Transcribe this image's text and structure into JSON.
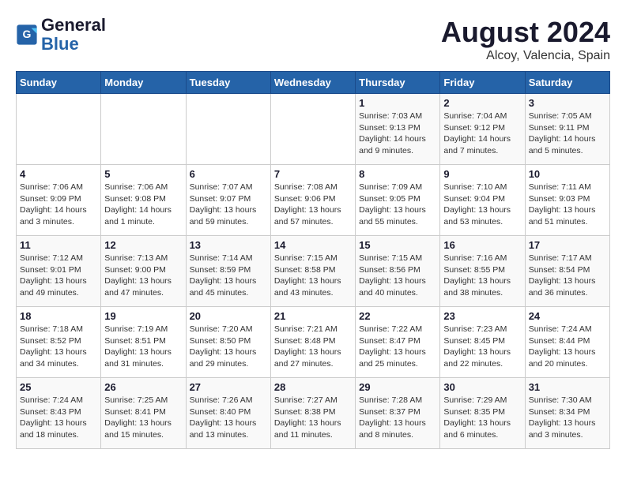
{
  "logo": {
    "text_general": "General",
    "text_blue": "Blue"
  },
  "title": "August 2024",
  "subtitle": "Alcoy, Valencia, Spain",
  "days_of_week": [
    "Sunday",
    "Monday",
    "Tuesday",
    "Wednesday",
    "Thursday",
    "Friday",
    "Saturday"
  ],
  "weeks": [
    [
      {
        "day": "",
        "info": ""
      },
      {
        "day": "",
        "info": ""
      },
      {
        "day": "",
        "info": ""
      },
      {
        "day": "",
        "info": ""
      },
      {
        "day": "1",
        "info": "Sunrise: 7:03 AM\nSunset: 9:13 PM\nDaylight: 14 hours and 9 minutes."
      },
      {
        "day": "2",
        "info": "Sunrise: 7:04 AM\nSunset: 9:12 PM\nDaylight: 14 hours and 7 minutes."
      },
      {
        "day": "3",
        "info": "Sunrise: 7:05 AM\nSunset: 9:11 PM\nDaylight: 14 hours and 5 minutes."
      }
    ],
    [
      {
        "day": "4",
        "info": "Sunrise: 7:06 AM\nSunset: 9:09 PM\nDaylight: 14 hours and 3 minutes."
      },
      {
        "day": "5",
        "info": "Sunrise: 7:06 AM\nSunset: 9:08 PM\nDaylight: 14 hours and 1 minute."
      },
      {
        "day": "6",
        "info": "Sunrise: 7:07 AM\nSunset: 9:07 PM\nDaylight: 13 hours and 59 minutes."
      },
      {
        "day": "7",
        "info": "Sunrise: 7:08 AM\nSunset: 9:06 PM\nDaylight: 13 hours and 57 minutes."
      },
      {
        "day": "8",
        "info": "Sunrise: 7:09 AM\nSunset: 9:05 PM\nDaylight: 13 hours and 55 minutes."
      },
      {
        "day": "9",
        "info": "Sunrise: 7:10 AM\nSunset: 9:04 PM\nDaylight: 13 hours and 53 minutes."
      },
      {
        "day": "10",
        "info": "Sunrise: 7:11 AM\nSunset: 9:03 PM\nDaylight: 13 hours and 51 minutes."
      }
    ],
    [
      {
        "day": "11",
        "info": "Sunrise: 7:12 AM\nSunset: 9:01 PM\nDaylight: 13 hours and 49 minutes."
      },
      {
        "day": "12",
        "info": "Sunrise: 7:13 AM\nSunset: 9:00 PM\nDaylight: 13 hours and 47 minutes."
      },
      {
        "day": "13",
        "info": "Sunrise: 7:14 AM\nSunset: 8:59 PM\nDaylight: 13 hours and 45 minutes."
      },
      {
        "day": "14",
        "info": "Sunrise: 7:15 AM\nSunset: 8:58 PM\nDaylight: 13 hours and 43 minutes."
      },
      {
        "day": "15",
        "info": "Sunrise: 7:15 AM\nSunset: 8:56 PM\nDaylight: 13 hours and 40 minutes."
      },
      {
        "day": "16",
        "info": "Sunrise: 7:16 AM\nSunset: 8:55 PM\nDaylight: 13 hours and 38 minutes."
      },
      {
        "day": "17",
        "info": "Sunrise: 7:17 AM\nSunset: 8:54 PM\nDaylight: 13 hours and 36 minutes."
      }
    ],
    [
      {
        "day": "18",
        "info": "Sunrise: 7:18 AM\nSunset: 8:52 PM\nDaylight: 13 hours and 34 minutes."
      },
      {
        "day": "19",
        "info": "Sunrise: 7:19 AM\nSunset: 8:51 PM\nDaylight: 13 hours and 31 minutes."
      },
      {
        "day": "20",
        "info": "Sunrise: 7:20 AM\nSunset: 8:50 PM\nDaylight: 13 hours and 29 minutes."
      },
      {
        "day": "21",
        "info": "Sunrise: 7:21 AM\nSunset: 8:48 PM\nDaylight: 13 hours and 27 minutes."
      },
      {
        "day": "22",
        "info": "Sunrise: 7:22 AM\nSunset: 8:47 PM\nDaylight: 13 hours and 25 minutes."
      },
      {
        "day": "23",
        "info": "Sunrise: 7:23 AM\nSunset: 8:45 PM\nDaylight: 13 hours and 22 minutes."
      },
      {
        "day": "24",
        "info": "Sunrise: 7:24 AM\nSunset: 8:44 PM\nDaylight: 13 hours and 20 minutes."
      }
    ],
    [
      {
        "day": "25",
        "info": "Sunrise: 7:24 AM\nSunset: 8:43 PM\nDaylight: 13 hours and 18 minutes."
      },
      {
        "day": "26",
        "info": "Sunrise: 7:25 AM\nSunset: 8:41 PM\nDaylight: 13 hours and 15 minutes."
      },
      {
        "day": "27",
        "info": "Sunrise: 7:26 AM\nSunset: 8:40 PM\nDaylight: 13 hours and 13 minutes."
      },
      {
        "day": "28",
        "info": "Sunrise: 7:27 AM\nSunset: 8:38 PM\nDaylight: 13 hours and 11 minutes."
      },
      {
        "day": "29",
        "info": "Sunrise: 7:28 AM\nSunset: 8:37 PM\nDaylight: 13 hours and 8 minutes."
      },
      {
        "day": "30",
        "info": "Sunrise: 7:29 AM\nSunset: 8:35 PM\nDaylight: 13 hours and 6 minutes."
      },
      {
        "day": "31",
        "info": "Sunrise: 7:30 AM\nSunset: 8:34 PM\nDaylight: 13 hours and 3 minutes."
      }
    ]
  ]
}
